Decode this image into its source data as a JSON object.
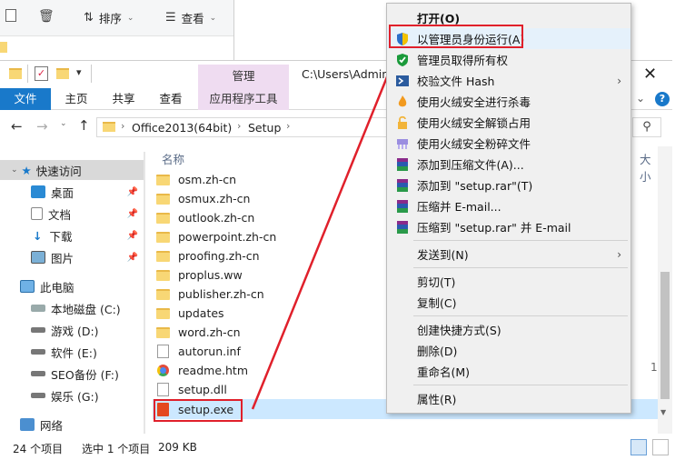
{
  "bg_toolbar": {
    "sort_label": "排序",
    "view_label": "查看"
  },
  "ribbon": {
    "file": "文件",
    "home": "主页",
    "share": "共享",
    "view": "查看",
    "manage": "管理",
    "app_tools": "应用程序工具"
  },
  "title": {
    "path": "C:\\Users\\Admin"
  },
  "address": {
    "crumb1": "Office2013(64bit)",
    "crumb2": "Setup"
  },
  "nav": {
    "quick_access": "快速访问",
    "items": [
      {
        "label": "桌面"
      },
      {
        "label": "文档"
      },
      {
        "label": "下载"
      },
      {
        "label": "图片"
      }
    ],
    "this_pc": "此电脑",
    "drives": [
      {
        "label": "本地磁盘 (C:)"
      },
      {
        "label": "游戏 (D:)"
      },
      {
        "label": "软件 (E:)"
      },
      {
        "label": "SEO备份 (F:)"
      },
      {
        "label": "娱乐 (G:)"
      }
    ],
    "network": "网络"
  },
  "files": {
    "col_name": "名称",
    "col_size": "大小",
    "rows": [
      {
        "name": "osm.zh-cn"
      },
      {
        "name": "osmux.zh-cn"
      },
      {
        "name": "outlook.zh-cn"
      },
      {
        "name": "powerpoint.zh-cn"
      },
      {
        "name": "proofing.zh-cn"
      },
      {
        "name": "proplus.ww"
      },
      {
        "name": "publisher.zh-cn"
      },
      {
        "name": "updates"
      },
      {
        "name": "word.zh-cn"
      },
      {
        "name": "autorun.inf"
      },
      {
        "name": "readme.htm"
      },
      {
        "name": "setup.dll"
      },
      {
        "name": "setup.exe"
      }
    ],
    "side_number": "1"
  },
  "status": {
    "count": "24 个项目",
    "selected": "选中 1 个项目",
    "size": "209 KB"
  },
  "context_menu": {
    "items": [
      {
        "label": "打开(O)"
      },
      {
        "label": "以管理员身份运行(A)"
      },
      {
        "label": "管理员取得所有权"
      },
      {
        "label": "校验文件 Hash"
      },
      {
        "label": "使用火绒安全进行杀毒"
      },
      {
        "label": "使用火绒安全解锁占用"
      },
      {
        "label": "使用火绒安全粉碎文件"
      },
      {
        "label": "添加到压缩文件(A)..."
      },
      {
        "label": "添加到 \"setup.rar\"(T)"
      },
      {
        "label": "压缩并 E-mail..."
      },
      {
        "label": "压缩到 \"setup.rar\" 并 E-mail"
      },
      {
        "label": "发送到(N)"
      },
      {
        "label": "剪切(T)"
      },
      {
        "label": "复制(C)"
      },
      {
        "label": "创建快捷方式(S)"
      },
      {
        "label": "删除(D)"
      },
      {
        "label": "重命名(M)"
      },
      {
        "label": "属性(R)"
      }
    ]
  },
  "colors": {
    "accent": "#1979ca",
    "highlight_red": "#e0202b",
    "manage_tab": "#efdcf1",
    "selection": "#cce8ff"
  }
}
